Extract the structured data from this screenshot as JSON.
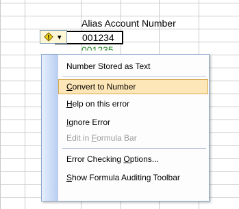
{
  "sheet": {
    "header_label": "Alias Account Number",
    "active_value": "001234",
    "next_value": "001235"
  },
  "smart_tag": {
    "icon": "warning-icon",
    "dropdown_icon": "chevron-down-icon"
  },
  "menu": {
    "items": [
      {
        "label": "Number Stored as Text",
        "accel": "",
        "state": "title"
      },
      {
        "label": "Convert to Number",
        "accel": "C",
        "state": "highlighted"
      },
      {
        "label": "Help on this error",
        "accel": "H",
        "state": "normal"
      },
      {
        "label": "Ignore Error",
        "accel": "I",
        "state": "normal"
      },
      {
        "label": "Edit in Formula Bar",
        "accel": "F",
        "state": "disabled"
      },
      {
        "label": "Error Checking Options...",
        "accel": "O",
        "state": "normal"
      },
      {
        "label": "Show Formula Auditing Toolbar",
        "accel": "S",
        "state": "normal"
      }
    ]
  },
  "colors": {
    "highlight_bg": "#fde6b7",
    "highlight_border": "#d6a64a",
    "gridline": "#c9c9c9",
    "warning_yellow": "#f3d21a"
  }
}
